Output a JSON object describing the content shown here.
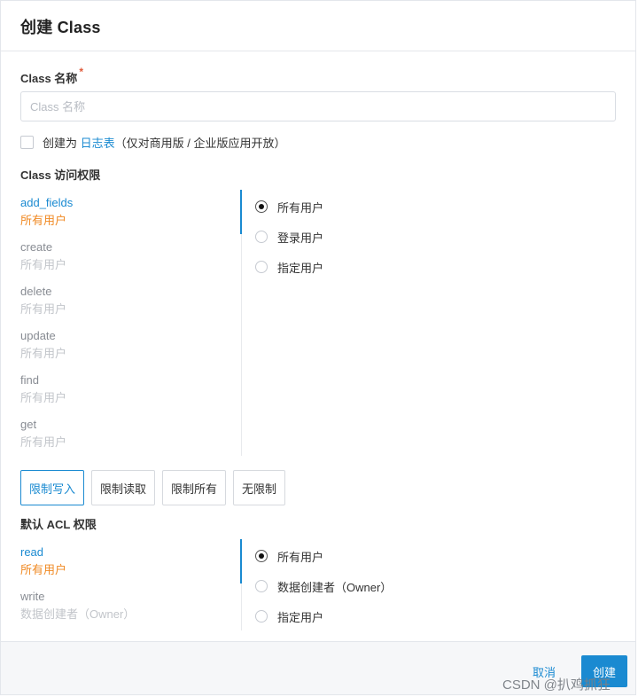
{
  "dialog": {
    "title": "创建 Class"
  },
  "name_field": {
    "label": "Class 名称",
    "required_mark": "*",
    "placeholder": "Class 名称",
    "value": ""
  },
  "log_table": {
    "checked": false,
    "prefix": "创建为 ",
    "link": "日志表",
    "suffix": "（仅对商用版 / 企业版应用开放）"
  },
  "class_permissions": {
    "label": "Class 访问权限",
    "operations": [
      {
        "name": "add_fields",
        "value": "所有用户"
      },
      {
        "name": "create",
        "value": "所有用户"
      },
      {
        "name": "delete",
        "value": "所有用户"
      },
      {
        "name": "update",
        "value": "所有用户"
      },
      {
        "name": "find",
        "value": "所有用户"
      },
      {
        "name": "get",
        "value": "所有用户"
      }
    ],
    "options": [
      "所有用户",
      "登录用户",
      "指定用户"
    ],
    "selected_option": "所有用户"
  },
  "presets": {
    "buttons": [
      "限制写入",
      "限制读取",
      "限制所有",
      "无限制"
    ],
    "active": "限制写入"
  },
  "default_acl": {
    "label": "默认 ACL 权限",
    "operations": [
      {
        "name": "read",
        "value": "所有用户"
      },
      {
        "name": "write",
        "value": "数据创建者（Owner）"
      }
    ],
    "options": [
      "所有用户",
      "数据创建者（Owner）",
      "指定用户"
    ],
    "selected_option": "所有用户"
  },
  "footer": {
    "cancel_label": "取消",
    "create_label": "创建",
    "watermark": "CSDN @扒鸡抓狂"
  },
  "colors": {
    "accent": "#1a8ad1",
    "active_value": "#f08a24",
    "required": "#e05a3a"
  }
}
